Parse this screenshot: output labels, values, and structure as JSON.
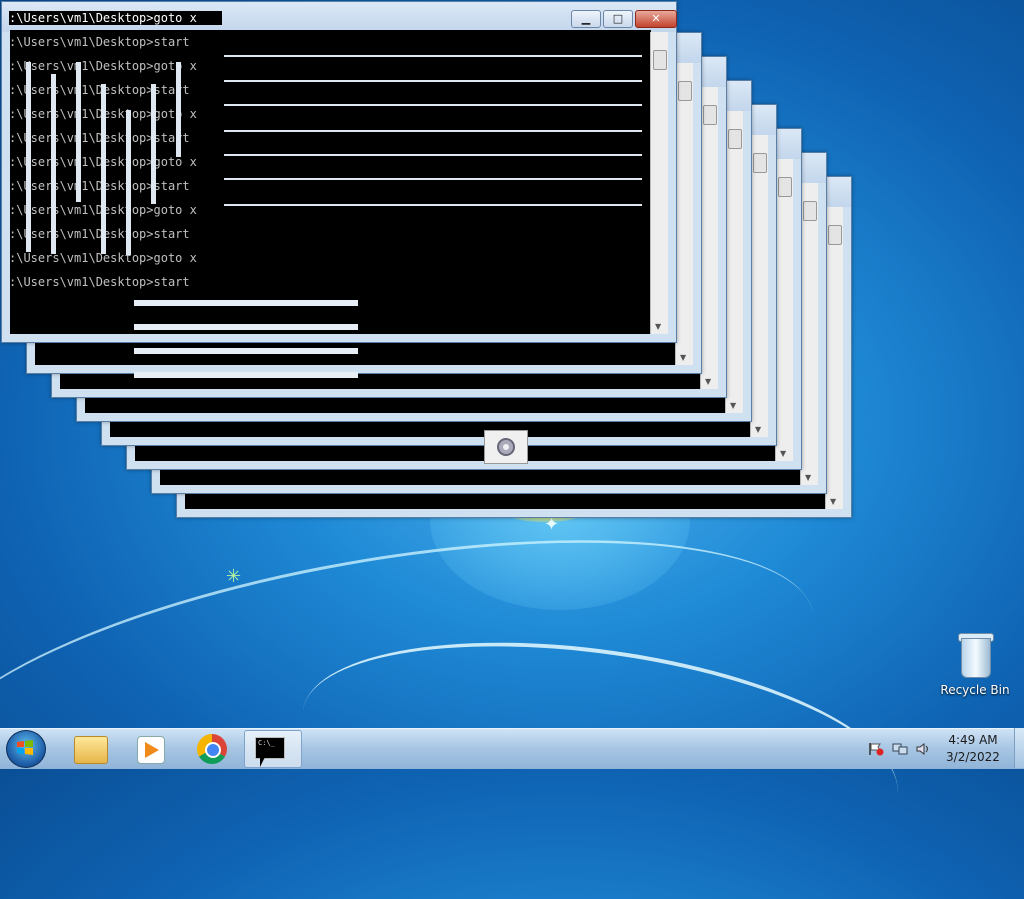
{
  "desktop": {
    "icons": [
      {
        "name": "Google Chrome",
        "label": ""
      },
      {
        "name": "Recycle Bin",
        "label": "Recycle Bin"
      }
    ]
  },
  "cmd_windows": {
    "count": 8,
    "lines": [
      ":\\Users\\vm1\\Desktop>goto x",
      ":\\Users\\vm1\\Desktop>start",
      ":\\Users\\vm1\\Desktop>goto x",
      ":\\Users\\vm1\\Desktop>start",
      ":\\Users\\vm1\\Desktop>goto x",
      ":\\Users\\vm1\\Desktop>start",
      ":\\Users\\vm1\\Desktop>goto x",
      ":\\Users\\vm1\\Desktop>start",
      ":\\Users\\vm1\\Desktop>goto x",
      ":\\Users\\vm1\\Desktop>start",
      ":\\Users\\vm1\\Desktop>goto x",
      ":\\Users\\vm1\\Desktop>start"
    ],
    "minimize_glyph": "▁",
    "maximize_glyph": "□",
    "close_glyph": "✕"
  },
  "taskbar": {
    "items": [
      "Start",
      "Windows Explorer",
      "Windows Media Player",
      "Google Chrome",
      "Command Prompt"
    ],
    "cmd_icon_text": "C:\\_",
    "clock_time": "4:49 AM",
    "clock_date": "3/2/2022"
  }
}
